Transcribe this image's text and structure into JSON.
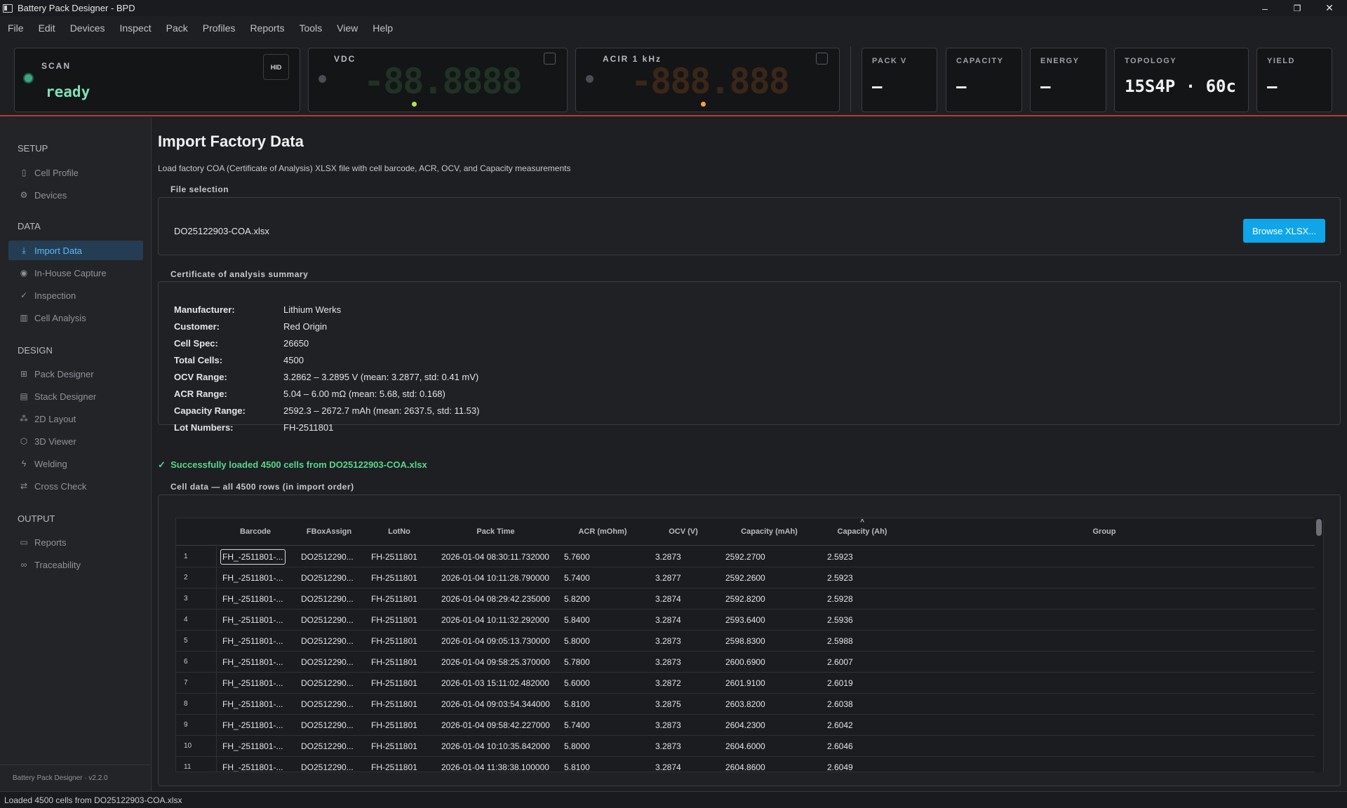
{
  "window": {
    "title": "Battery Pack Designer - BPD",
    "minimize": "–",
    "maximize": "❐",
    "close": "✕"
  },
  "menu": [
    "File",
    "Edit",
    "Devices",
    "Inspect",
    "Pack",
    "Profiles",
    "Reports",
    "Tools",
    "View",
    "Help"
  ],
  "meters": {
    "scan": {
      "label": "SCAN",
      "status": "ready",
      "hid": "HID"
    },
    "vdc": {
      "label": "VDC",
      "display": "-88.8888"
    },
    "acir": {
      "label": "ACIR  1 kHz",
      "display": "-888.888"
    }
  },
  "stats": [
    {
      "label": "PACK V",
      "value": "—"
    },
    {
      "label": "CAPACITY",
      "value": "—"
    },
    {
      "label": "ENERGY",
      "value": "—"
    },
    {
      "label": "TOPOLOGY",
      "value": "15S4P · 60c"
    },
    {
      "label": "YIELD",
      "value": "—"
    }
  ],
  "sidebar": {
    "sections": {
      "setup": "SETUP",
      "data": "DATA",
      "design": "DESIGN",
      "output": "OUTPUT"
    },
    "items": {
      "cell_profile": "Cell Profile",
      "devices": "Devices",
      "import_data": "Import Data",
      "inhouse_capture": "In-House Capture",
      "inspection": "Inspection",
      "cell_analysis": "Cell Analysis",
      "pack_designer": "Pack Designer",
      "stack_designer": "Stack Designer",
      "layout_2d": "2D Layout",
      "viewer_3d": "3D Viewer",
      "welding": "Welding",
      "cross_check": "Cross Check",
      "reports": "Reports",
      "traceability": "Traceability"
    },
    "footer": "Battery Pack Designer · v2.2.0"
  },
  "page": {
    "title": "Import Factory Data",
    "subtitle": "Load factory COA (Certificate of Analysis) XLSX file with cell barcode, ACR, OCV, and Capacity measurements",
    "file_group": "File selection",
    "file_name": "DO25122903-COA.xlsx",
    "browse": "Browse XLSX...",
    "summary_group": "Certificate of analysis summary",
    "summary": [
      {
        "k": "Manufacturer:",
        "v": "Lithium Werks"
      },
      {
        "k": "Customer:",
        "v": "Red Origin"
      },
      {
        "k": "Cell Spec:",
        "v": "26650"
      },
      {
        "k": "Total Cells:",
        "v": "4500"
      },
      {
        "k": "OCV Range:",
        "v": "3.2862 – 3.2895 V  (mean: 3.2877, std: 0.41 mV)"
      },
      {
        "k": "ACR Range:",
        "v": "5.04 – 6.00 mΩ  (mean: 5.68, std: 0.168)"
      },
      {
        "k": "Capacity Range:",
        "v": "2592.3 – 2672.7 mAh  (mean: 2637.5, std: 11.53)"
      },
      {
        "k": "Lot Numbers:",
        "v": "FH-2511801"
      }
    ],
    "success_icon": "✓",
    "success": "Successfully loaded 4500 cells from DO25122903-COA.xlsx",
    "table_group": "Cell data — all 4500 rows (in import order)"
  },
  "table": {
    "columns": [
      "Barcode",
      "FBoxAssign",
      "LotNo",
      "Pack Time",
      "ACR (mOhm)",
      "OCV (V)",
      "Capacity (mAh)",
      "Capacity (Ah)",
      "Group"
    ],
    "sort_indicator": "^",
    "rows": [
      [
        "1",
        "FH_-2511801-...",
        "DO2512290...",
        "FH-2511801",
        "2026-01-04 08:30:11.732000",
        "5.7600",
        "3.2873",
        "2592.2700",
        "2.5923"
      ],
      [
        "2",
        "FH_-2511801-...",
        "DO2512290...",
        "FH-2511801",
        "2026-01-04 10:11:28.790000",
        "5.7400",
        "3.2877",
        "2592.2600",
        "2.5923"
      ],
      [
        "3",
        "FH_-2511801-...",
        "DO2512290...",
        "FH-2511801",
        "2026-01-04 08:29:42.235000",
        "5.8200",
        "3.2874",
        "2592.8200",
        "2.5928"
      ],
      [
        "4",
        "FH_-2511801-...",
        "DO2512290...",
        "FH-2511801",
        "2026-01-04 10:11:32.292000",
        "5.8400",
        "3.2874",
        "2593.6400",
        "2.5936"
      ],
      [
        "5",
        "FH_-2511801-...",
        "DO2512290...",
        "FH-2511801",
        "2026-01-04 09:05:13.730000",
        "5.8000",
        "3.2873",
        "2598.8300",
        "2.5988"
      ],
      [
        "6",
        "FH_-2511801-...",
        "DO2512290...",
        "FH-2511801",
        "2026-01-04 09:58:25.370000",
        "5.7800",
        "3.2873",
        "2600.6900",
        "2.6007"
      ],
      [
        "7",
        "FH_-2511801-...",
        "DO2512290...",
        "FH-2511801",
        "2026-01-03 15:11:02.482000",
        "5.6000",
        "3.2872",
        "2601.9100",
        "2.6019"
      ],
      [
        "8",
        "FH_-2511801-...",
        "DO2512290...",
        "FH-2511801",
        "2026-01-04 09:03:54.344000",
        "5.8100",
        "3.2875",
        "2603.8200",
        "2.6038"
      ],
      [
        "9",
        "FH_-2511801-...",
        "DO2512290...",
        "FH-2511801",
        "2026-01-04 09:58:42.227000",
        "5.7400",
        "3.2873",
        "2604.2300",
        "2.6042"
      ],
      [
        "10",
        "FH_-2511801-...",
        "DO2512290...",
        "FH-2511801",
        "2026-01-04 10:10:35.842000",
        "5.8000",
        "3.2873",
        "2604.6000",
        "2.6046"
      ],
      [
        "11",
        "FH_-2511801-...",
        "DO2512290...",
        "FH-2511801",
        "2026-01-04 11:38:38.100000",
        "5.8100",
        "3.2874",
        "2604.8600",
        "2.6049"
      ]
    ]
  },
  "statusbar": "Loaded 4500 cells from DO25122903-COA.xlsx",
  "colors": {
    "accent": "#0fa6e9",
    "success": "#58d68d",
    "ready": "#7fe0b5",
    "alarm_line": "#c0392b"
  }
}
